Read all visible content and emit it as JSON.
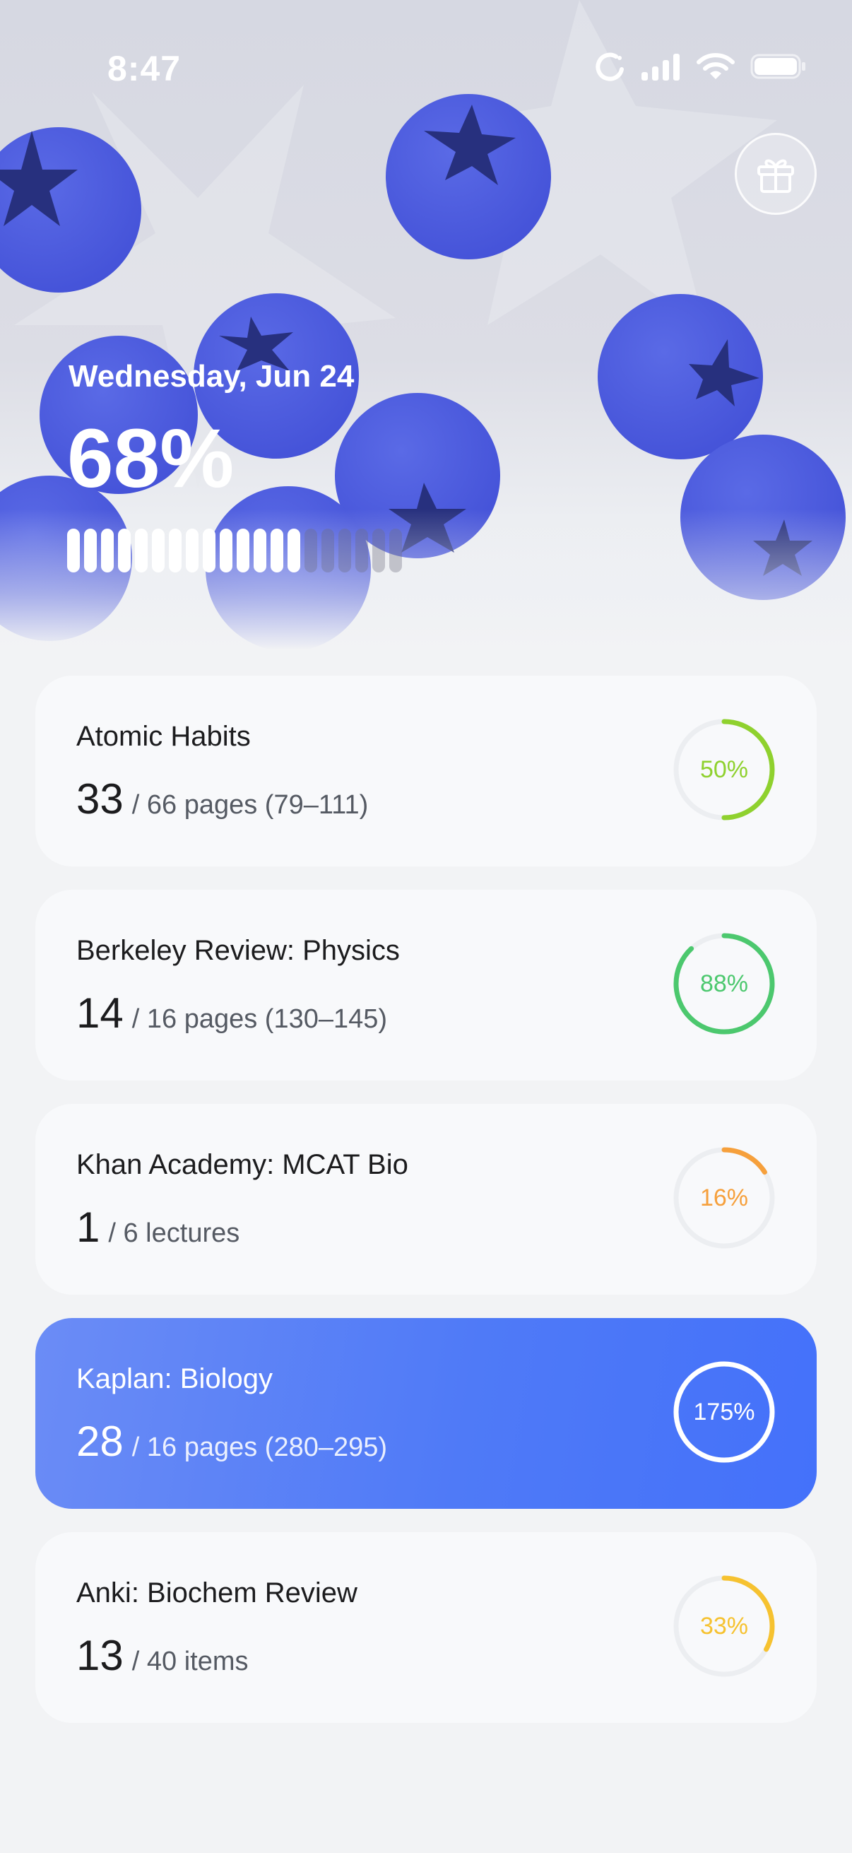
{
  "status_bar": {
    "time": "8:47",
    "icons": [
      "focus-moon-icon",
      "cellular-signal-icon",
      "wifi-icon",
      "battery-icon"
    ]
  },
  "header": {
    "gift_icon": "gift-icon",
    "date": "Wednesday, Jun 24",
    "percent": "68%",
    "progress_fraction": 0.68,
    "accent_color": "#4f62dd"
  },
  "items": [
    {
      "title": "Atomic Habits",
      "count": "33",
      "detail": "/ 66 pages (79–111)",
      "percent_label": "50%",
      "fraction": 0.5,
      "color": "#8fd12e",
      "highlighted": false
    },
    {
      "title": "Berkeley Review: Physics",
      "count": "14",
      "detail": "/ 16 pages (130–145)",
      "percent_label": "88%",
      "fraction": 0.88,
      "color": "#4cc86e",
      "highlighted": false
    },
    {
      "title": "Khan Academy: MCAT Bio",
      "count": "1",
      "detail": "/ 6 lectures",
      "percent_label": "16%",
      "fraction": 0.16,
      "color": "#f6a03c",
      "highlighted": false
    },
    {
      "title": "Kaplan: Biology",
      "count": "28",
      "detail": "/ 16 pages (280–295)",
      "percent_label": "175%",
      "fraction": 1.0,
      "color": "#ffffff",
      "highlighted": true
    },
    {
      "title": "Anki: Biochem Review",
      "count": "13",
      "detail": "/ 40 items",
      "percent_label": "33%",
      "fraction": 0.33,
      "color": "#f6c230",
      "highlighted": false
    }
  ]
}
